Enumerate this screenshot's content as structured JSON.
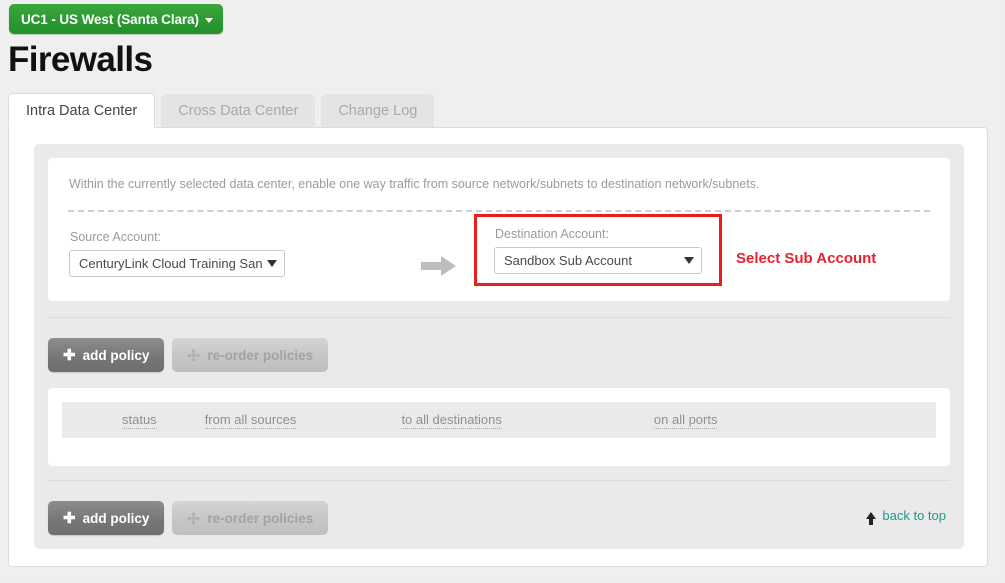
{
  "header": {
    "datacenter_badge": "UC1 - US West (Santa Clara)",
    "page_title": "Firewalls"
  },
  "tabs": [
    {
      "label": "Intra Data Center",
      "active": true
    },
    {
      "label": "Cross Data Center",
      "active": false
    },
    {
      "label": "Change Log",
      "active": false
    }
  ],
  "form": {
    "description": "Within the currently selected data center, enable one way traffic from source network/subnets to destination network/subnets.",
    "source": {
      "label": "Source Account:",
      "value": "CenturyLink Cloud Training Sandbox"
    },
    "destination": {
      "label": "Destination Account:",
      "value": "Sandbox Sub Account"
    },
    "annotation": "Select Sub Account",
    "annotation_color": "#e8212f",
    "highlight_color": "#ed1c1c"
  },
  "toolbar": {
    "add_policy_label": "add policy",
    "reorder_label": "re-order policies",
    "back_to_top_label": "back to top"
  },
  "table": {
    "columns": [
      {
        "label": "status"
      },
      {
        "label": "from all sources"
      },
      {
        "label": "to all destinations"
      },
      {
        "label": "on all ports"
      }
    ],
    "rows": []
  }
}
